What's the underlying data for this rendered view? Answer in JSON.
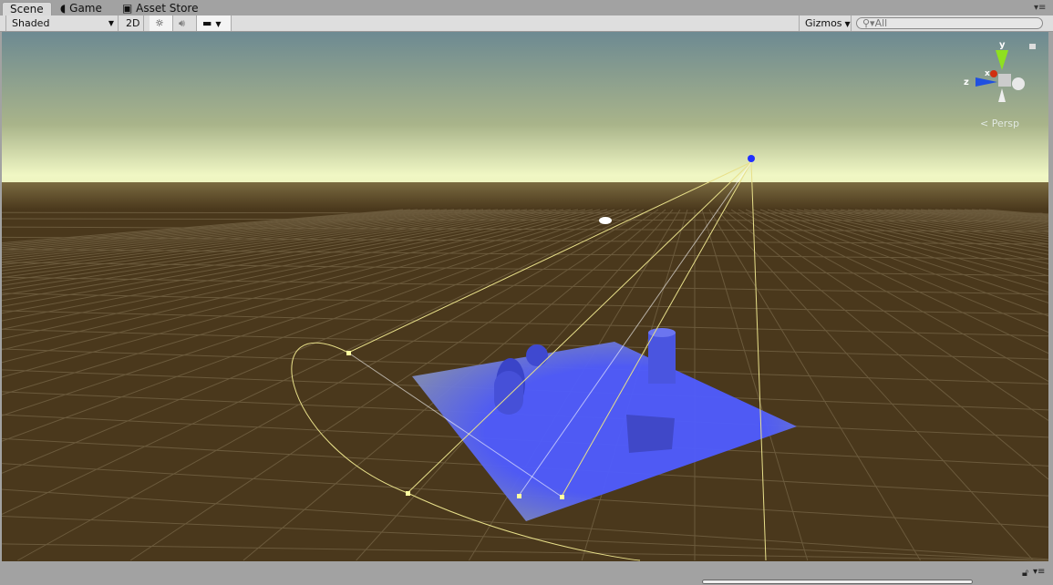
{
  "tabs": [
    {
      "label": "Scene",
      "icon": "scene-icon"
    },
    {
      "label": "Game",
      "icon": "pacman-icon"
    },
    {
      "label": "Asset Store",
      "icon": "bag-icon"
    }
  ],
  "toolbar": {
    "draw_mode": "Shaded",
    "mode_2d": "2D",
    "gizmos": "Gizmos",
    "search_placeholder": "All"
  },
  "gizmo": {
    "y": "y",
    "x": "x",
    "z": "z",
    "projection": "Persp"
  },
  "colors": {
    "sky_top": "#6d8a92",
    "horizon": "#f0f7c4",
    "ground": "#4a381c",
    "plane": "#4f5cff",
    "gizmo_line": "#e8e08a"
  }
}
